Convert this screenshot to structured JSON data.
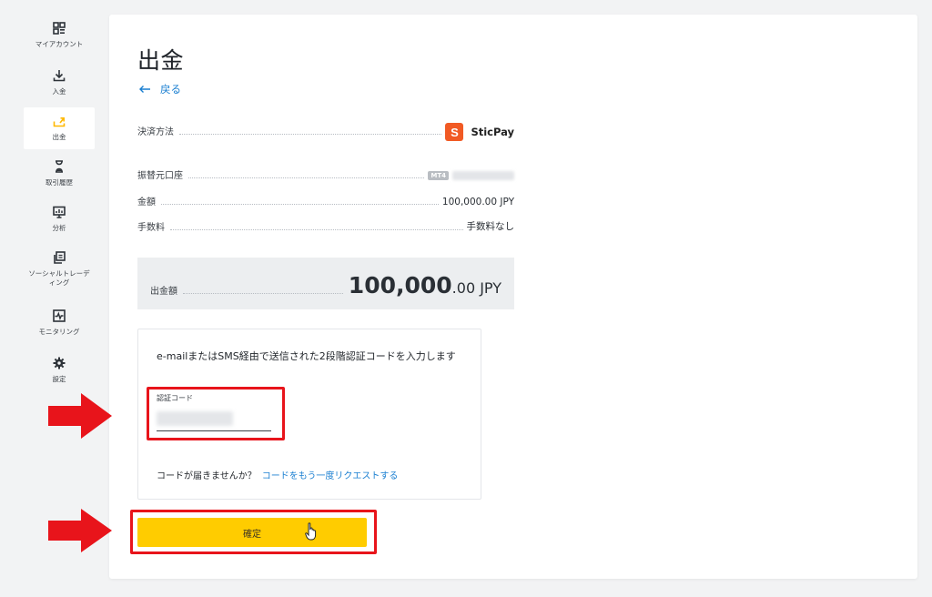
{
  "sidebar": {
    "items": [
      {
        "label": "マイアカウント",
        "icon": "dashboard-icon",
        "active": false
      },
      {
        "label": "入金",
        "icon": "download-icon",
        "active": false
      },
      {
        "label": "出金",
        "icon": "upload-icon",
        "active": true
      },
      {
        "label": "取引履歴",
        "icon": "hourglass-icon",
        "active": false
      },
      {
        "label": "分析",
        "icon": "presentation-chart-icon",
        "active": false
      },
      {
        "label": "ソーシャルトレーディング",
        "icon": "copy-icon",
        "active": false
      },
      {
        "label": "モニタリング",
        "icon": "pulse-monitor-icon",
        "active": false
      },
      {
        "label": "設定",
        "icon": "gear-icon",
        "active": false
      }
    ],
    "active_color": "#ffb800"
  },
  "main": {
    "title": "出金",
    "back_label": "戻る",
    "payment_method": {
      "label": "決済方法",
      "logo_letter": "S",
      "value": "SticPay"
    },
    "source_account": {
      "label": "振替元口座",
      "badge": "MT4"
    },
    "amount": {
      "label": "金額",
      "value": "100,000.00 JPY"
    },
    "fee": {
      "label": "手数料",
      "value": "手数料なし"
    },
    "total": {
      "label": "出金額",
      "amount_major": "100,000",
      "amount_minor": ".00 JPY"
    },
    "auth": {
      "instruction": "e-mailまたはSMS経由で送信された2段階認証コードを入力します",
      "code_label": "認証コード",
      "resend_prompt": "コードが届きませんか？",
      "resend_link": "コードをもう一度リクエストする"
    },
    "confirm_label": "確定"
  },
  "colors": {
    "accent_yellow": "#ffcc00",
    "link_blue": "#1a7fd1",
    "annotation_red": "#e8141b",
    "sticpay_orange": "#f15a24"
  }
}
